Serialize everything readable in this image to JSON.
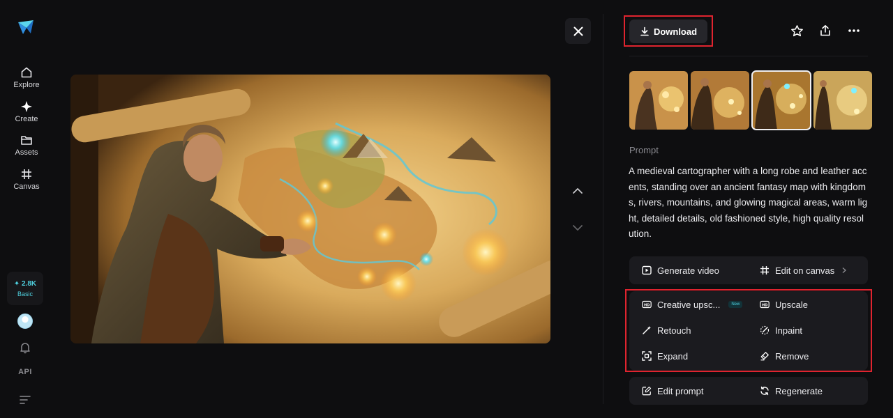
{
  "sidebar": {
    "items": [
      {
        "label": "Explore",
        "icon": "home-icon"
      },
      {
        "label": "Create",
        "icon": "sparkle-icon"
      },
      {
        "label": "Assets",
        "icon": "folder-icon"
      },
      {
        "label": "Canvas",
        "icon": "canvas-grid-icon"
      }
    ],
    "credits": {
      "amount": "✦ 2.8K",
      "plan": "Basic"
    },
    "api_label": "API"
  },
  "toolbar": {
    "download_label": "Download"
  },
  "prompt": {
    "label": "Prompt",
    "text": "A medieval cartographer with a long robe and leather accents, standing over an ancient fantasy map with kingdoms, rivers, mountains, and glowing magical areas, warm light, detailed details, old fashioned style, high quality resolution."
  },
  "actions": {
    "generate_video": "Generate video",
    "edit_on_canvas": "Edit on canvas",
    "creative_upscale": "Creative upsc...",
    "new_badge": "New",
    "upscale": "Upscale",
    "retouch": "Retouch",
    "inpaint": "Inpaint",
    "expand": "Expand",
    "remove": "Remove",
    "edit_prompt": "Edit prompt",
    "regenerate": "Regenerate"
  },
  "colors": {
    "accent": "#4fd1e0",
    "highlight_frame": "#e0242f",
    "background": "#0e0e10",
    "card": "#1b1b1f"
  }
}
